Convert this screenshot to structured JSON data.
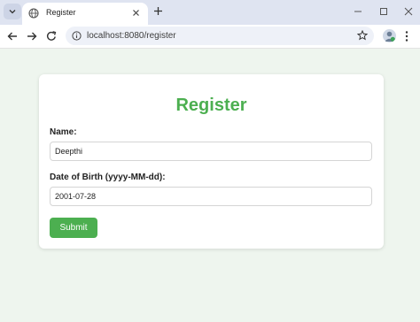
{
  "browser": {
    "tab_title": "Register",
    "url": "localhost:8080/register",
    "icons": {
      "tab_menu": "chevron-down-icon",
      "favicon": "globe-icon",
      "tab_close": "close-icon",
      "new_tab": "plus-icon",
      "minimize": "minimize-icon",
      "maximize": "maximize-icon",
      "window_close": "close-icon",
      "back": "arrow-left-icon",
      "forward": "arrow-right-icon",
      "reload": "reload-icon",
      "site_info": "info-icon",
      "bookmark": "star-icon",
      "profile": "avatar",
      "menu": "kebab-menu-icon"
    }
  },
  "form": {
    "title": "Register",
    "name_label": "Name:",
    "name_value": "Deepthi",
    "dob_label": "Date of Birth (yyyy-MM-dd):",
    "dob_value": "2001-07-28",
    "submit_label": "Submit"
  },
  "colors": {
    "accent": "#4caf50",
    "page_background": "#eef5ee",
    "tabstrip": "#dfe4f1"
  }
}
